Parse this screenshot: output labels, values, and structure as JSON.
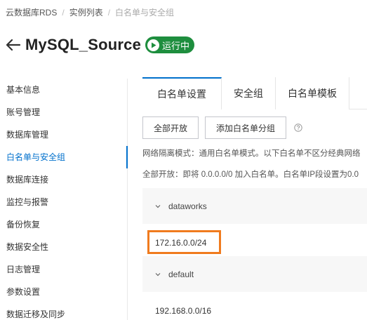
{
  "breadcrumb": {
    "items": [
      "云数据库RDS",
      "实例列表",
      "白名单与安全组"
    ],
    "separator": "/"
  },
  "header": {
    "title": "MySQL_Source",
    "status": "运行中",
    "status_color": "#1e8e3e"
  },
  "sidebar": {
    "items": [
      {
        "label": "基本信息"
      },
      {
        "label": "账号管理"
      },
      {
        "label": "数据库管理"
      },
      {
        "label": "白名单与安全组"
      },
      {
        "label": "数据库连接"
      },
      {
        "label": "监控与报警"
      },
      {
        "label": "备份恢复"
      },
      {
        "label": "数据安全性"
      },
      {
        "label": "日志管理"
      },
      {
        "label": "参数设置"
      },
      {
        "label": "数据迁移及同步"
      }
    ],
    "active_index": 3
  },
  "tabs": [
    {
      "label": "白名单设置"
    },
    {
      "label": "安全组"
    },
    {
      "label": "白名单模板"
    }
  ],
  "actions": {
    "enable_all": "全部开放",
    "add_group": "添加白名单分组"
  },
  "desc": {
    "mode": "网络隔离模式：通用白名单模式。以下白名单不区分经典网络",
    "open_all": "全部开放：即将 0.0.0.0/0 加入白名单。白名单IP段设置为0.0"
  },
  "groups": [
    {
      "name": "dataworks",
      "ip": "172.16.0.0/24"
    },
    {
      "name": "default",
      "ip": "192.168.0.0/16"
    }
  ],
  "colors": {
    "accent": "#0070cc",
    "highlight": "#f07b1e"
  }
}
